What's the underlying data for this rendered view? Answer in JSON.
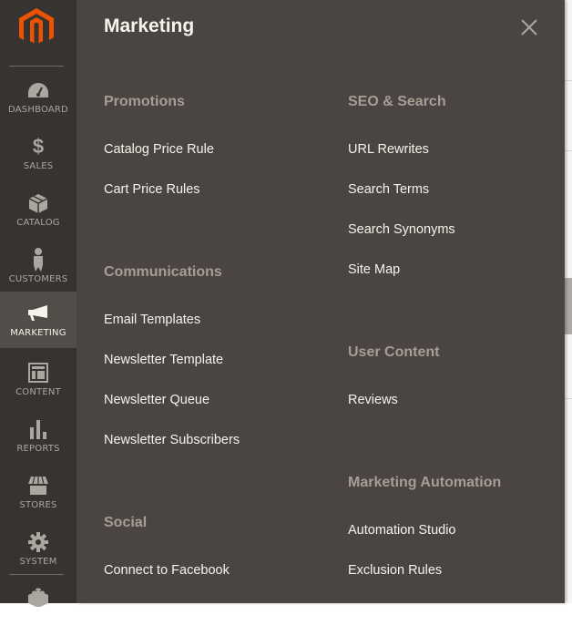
{
  "sidebar": {
    "items": [
      {
        "label": "Dashboard",
        "icon": "dashboard-icon"
      },
      {
        "label": "Sales",
        "icon": "dollar-icon"
      },
      {
        "label": "Catalog",
        "icon": "box-icon"
      },
      {
        "label": "Customers",
        "icon": "person-icon"
      },
      {
        "label": "Marketing",
        "icon": "megaphone-icon",
        "active": true
      },
      {
        "label": "Content",
        "icon": "layout-icon"
      },
      {
        "label": "Reports",
        "icon": "bar-chart-icon"
      },
      {
        "label": "Stores",
        "icon": "storefront-icon"
      },
      {
        "label": "System",
        "icon": "gear-icon"
      },
      {
        "label": "",
        "icon": "brick-icon"
      }
    ]
  },
  "colors": {
    "brand": "#eb5202",
    "sidebar_bg": "#373330",
    "panel_bg": "#4a4542",
    "active_bg": "#524d49"
  },
  "panel": {
    "title": "Marketing",
    "close_icon": "close-icon",
    "left_column": [
      {
        "title": "Promotions",
        "links": [
          "Catalog Price Rule",
          "Cart Price Rules"
        ]
      },
      {
        "title": "Communications",
        "links": [
          "Email Templates",
          "Newsletter Template",
          "Newsletter Queue",
          "Newsletter Subscribers"
        ]
      },
      {
        "title": "Social",
        "links": [
          "Connect to Facebook"
        ]
      }
    ],
    "right_column": [
      {
        "title": "SEO & Search",
        "links": [
          "URL Rewrites",
          "Search Terms",
          "Search Synonyms",
          "Site Map"
        ]
      },
      {
        "title": "User Content",
        "links": [
          "Reviews"
        ]
      },
      {
        "title": "Marketing Automation",
        "links": [
          "Automation Studio",
          "Exclusion Rules"
        ]
      }
    ]
  }
}
